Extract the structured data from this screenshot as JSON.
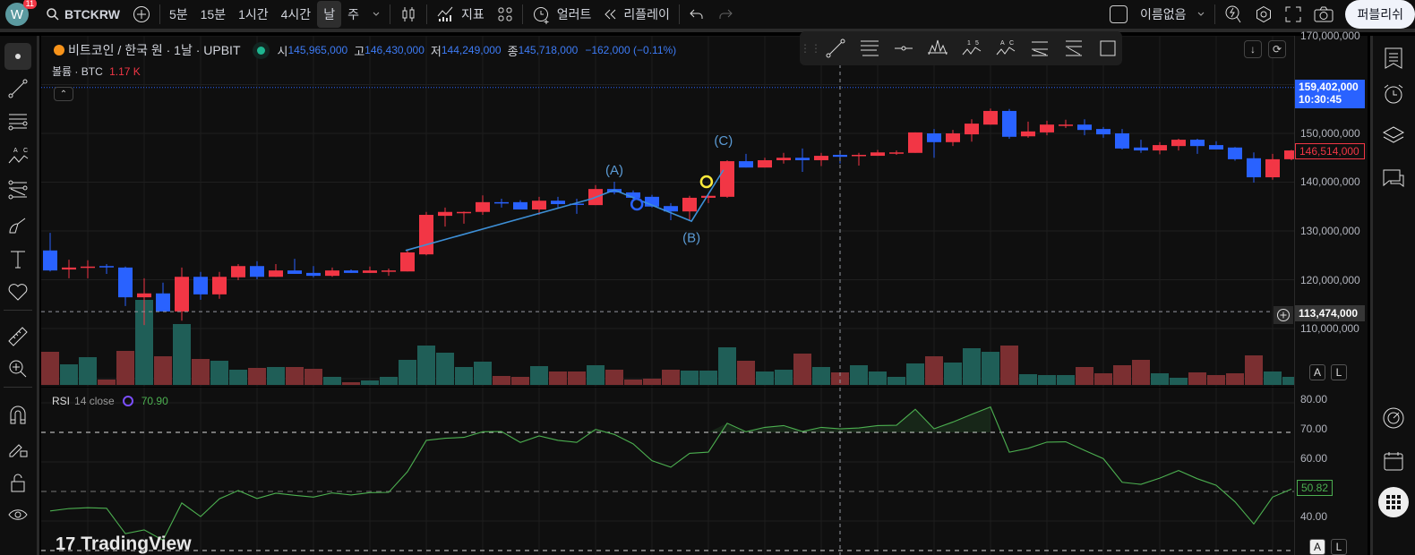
{
  "topbar": {
    "avatar_letter": "W",
    "notification_count": "11",
    "symbol": "BTCKRW",
    "timeframes": [
      "5분",
      "15분",
      "1시간",
      "4시간",
      "날",
      "주"
    ],
    "active_timeframe": "날",
    "indicators_label": "지표",
    "alert_label": "얼러트",
    "replay_label": "리플레이",
    "layout_name": "이름없음",
    "publish_label": "퍼블리쉬"
  },
  "legend": {
    "title": "비트코인 / 한국 원 · 1날 · UPBIT",
    "open_label": "시",
    "open": "145,965,000",
    "high_label": "고",
    "high": "146,430,000",
    "low_label": "저",
    "low": "144,249,000",
    "close_label": "종",
    "close": "145,718,000",
    "change": "−162,000 (−0.11%)"
  },
  "volume_legend": {
    "label": "볼륨 · BTC",
    "value": "1.17 K"
  },
  "rsi_legend": {
    "label": "RSI",
    "params": "14 close",
    "value": "70.90"
  },
  "price_axis": {
    "ticks": [
      "170,000,000",
      "150,000,000",
      "140,000,000",
      "130,000,000",
      "120,000,000",
      "110,000,000"
    ],
    "alert_price": "159,402,000",
    "countdown": "10:30:45",
    "last_price": "146,514,000",
    "crosshair_price": "113,474,000"
  },
  "rsi_axis": {
    "ticks": [
      "80.00",
      "70.00",
      "60.00",
      "40.00"
    ],
    "last_value": "50.82"
  },
  "axis_buttons": {
    "auto": "A",
    "log": "L"
  },
  "watermark": "TradingView",
  "colors": {
    "up": "#f23645",
    "down": "#2962ff",
    "vol_up": "#1f5e57",
    "vol_down": "#7b2f31",
    "rsi": "#4caf50",
    "wave": "#3d8fd6",
    "accent": "#2962ff"
  },
  "chart_data": {
    "type": "candlestick",
    "price_unit_note": "millions KRW",
    "ylim": [
      106,
      172
    ],
    "ohlc": [
      [
        126.0,
        129.6,
        121.7,
        121.9
      ],
      [
        122.1,
        124.1,
        120.3,
        122.5
      ],
      [
        122.6,
        124.0,
        120.3,
        122.7
      ],
      [
        122.8,
        123.2,
        121.2,
        122.6
      ],
      [
        122.5,
        122.7,
        114.6,
        116.4
      ],
      [
        116.4,
        120.3,
        110.7,
        117.2
      ],
      [
        117.2,
        119.4,
        113.5,
        113.5
      ],
      [
        113.5,
        122.5,
        111.6,
        120.6
      ],
      [
        120.6,
        121.6,
        115.9,
        117.0
      ],
      [
        117.0,
        121.6,
        116.1,
        120.6
      ],
      [
        120.5,
        123.2,
        119.9,
        122.8
      ],
      [
        122.8,
        123.8,
        120.1,
        120.6
      ],
      [
        120.6,
        123.2,
        120.6,
        121.9
      ],
      [
        121.9,
        124.3,
        121.2,
        121.2
      ],
      [
        121.4,
        122.8,
        120.5,
        120.8
      ],
      [
        120.8,
        122.5,
        120.6,
        121.9
      ],
      [
        121.9,
        122.1,
        121.4,
        121.4
      ],
      [
        121.4,
        122.7,
        121.4,
        121.9
      ],
      [
        121.7,
        122.3,
        120.8,
        121.9
      ],
      [
        121.7,
        126.2,
        121.7,
        125.6
      ],
      [
        125.2,
        133.9,
        125.0,
        133.3
      ],
      [
        133.1,
        134.8,
        130.9,
        133.9
      ],
      [
        133.7,
        134.0,
        131.5,
        133.9
      ],
      [
        133.9,
        137.3,
        133.3,
        135.9
      ],
      [
        135.9,
        136.6,
        134.8,
        135.7
      ],
      [
        135.9,
        136.3,
        134.4,
        134.4
      ],
      [
        134.4,
        137.0,
        133.3,
        136.2
      ],
      [
        136.2,
        137.0,
        134.8,
        135.5
      ],
      [
        135.6,
        136.6,
        133.5,
        135.5
      ],
      [
        135.3,
        139.4,
        135.3,
        138.6
      ],
      [
        138.6,
        140.1,
        137.5,
        137.9
      ],
      [
        137.9,
        138.3,
        136.6,
        136.8
      ],
      [
        137.0,
        137.4,
        134.8,
        135.0
      ],
      [
        135.1,
        135.7,
        132.2,
        134.0
      ],
      [
        134.0,
        137.2,
        132.2,
        136.8
      ],
      [
        136.8,
        137.7,
        135.7,
        137.2
      ],
      [
        137.0,
        144.5,
        136.8,
        144.3
      ],
      [
        144.3,
        145.8,
        143.0,
        143.0
      ],
      [
        143.0,
        145.0,
        143.0,
        144.5
      ],
      [
        144.5,
        146.0,
        143.8,
        145.0
      ],
      [
        145.0,
        146.9,
        142.1,
        144.5
      ],
      [
        144.5,
        146.0,
        143.3,
        145.4
      ],
      [
        145.6,
        145.8,
        143.8,
        145.2
      ],
      [
        145.4,
        146.0,
        143.4,
        145.6
      ],
      [
        145.4,
        146.6,
        145.4,
        146.1
      ],
      [
        145.9,
        146.5,
        145.6,
        146.1
      ],
      [
        146.0,
        150.2,
        146.0,
        150.2
      ],
      [
        150.0,
        150.9,
        145.0,
        148.2
      ],
      [
        148.2,
        150.7,
        147.4,
        150.0
      ],
      [
        149.8,
        152.9,
        148.3,
        152.0
      ],
      [
        151.8,
        155.1,
        151.8,
        154.6
      ],
      [
        154.6,
        155.0,
        148.9,
        149.3
      ],
      [
        149.4,
        152.4,
        149.1,
        150.4
      ],
      [
        150.2,
        152.6,
        149.6,
        151.8
      ],
      [
        151.7,
        152.8,
        151.1,
        151.8
      ],
      [
        151.8,
        152.9,
        149.6,
        150.7
      ],
      [
        150.9,
        151.3,
        149.1,
        149.8
      ],
      [
        150.0,
        150.9,
        146.7,
        146.9
      ],
      [
        147.1,
        148.7,
        146.0,
        146.5
      ],
      [
        146.5,
        148.2,
        145.7,
        147.6
      ],
      [
        147.4,
        148.9,
        146.5,
        148.7
      ],
      [
        148.7,
        148.9,
        145.8,
        147.4
      ],
      [
        147.6,
        148.4,
        146.7,
        146.7
      ],
      [
        147.1,
        147.2,
        144.4,
        144.7
      ],
      [
        144.9,
        146.1,
        139.9,
        141.0
      ],
      [
        141.0,
        145.8,
        140.5,
        144.7
      ],
      [
        144.7,
        146.6,
        144.5,
        146.5
      ]
    ],
    "volume_k": [
      4.81,
      2.99,
      4.03,
      0.78,
      4.94,
      12.35,
      4.16,
      8.84,
      3.77,
      3.51,
      2.21,
      2.47,
      2.6,
      2.6,
      2.34,
      1.17,
      0.39,
      0.65,
      1.17,
      3.64,
      5.72,
      4.68,
      2.6,
      3.38,
      1.3,
      1.17,
      2.73,
      1.95,
      1.95,
      2.86,
      2.21,
      0.78,
      0.91,
      2.21,
      2.08,
      2.08,
      5.46,
      3.51,
      1.95,
      2.21,
      4.55,
      2.6,
      1.82,
      2.86,
      1.95,
      1.17,
      3.12,
      4.16,
      3.25,
      5.33,
      4.81,
      5.72,
      1.56,
      1.43,
      1.43,
      2.6,
      1.69,
      2.86,
      3.64,
      1.69,
      1.04,
      1.82,
      1.43,
      1.69,
      4.29,
      1.95,
      1.17
    ],
    "rsi": [
      43.4,
      44.2,
      44.5,
      44.3,
      35.7,
      37.0,
      33.5,
      46.1,
      41.5,
      47.5,
      50.3,
      47.6,
      49.4,
      48.7,
      48.1,
      49.5,
      48.8,
      49.6,
      49.7,
      56.7,
      67.3,
      68.0,
      68.3,
      70.2,
      70.3,
      66.6,
      68.8,
      67.3,
      66.6,
      71.0,
      69.3,
      66.1,
      60.4,
      58.2,
      62.9,
      63.3,
      73.1,
      70.2,
      71.7,
      72.3,
      70.3,
      71.7,
      71.2,
      71.5,
      72.3,
      72.4,
      77.8,
      71.2,
      73.5,
      76.1,
      78.6,
      63.3,
      64.6,
      66.7,
      66.8,
      63.9,
      61.1,
      53.1,
      52.4,
      54.5,
      57.1,
      54.3,
      52.1,
      46.5,
      39.0,
      48.1,
      50.8
    ],
    "rsi_levels": [
      70,
      50,
      30
    ],
    "rsi_ylim": [
      25,
      90
    ],
    "price_grid": [
      110,
      120,
      130,
      140,
      150,
      160,
      170
    ],
    "alert_level": 159.402,
    "crosshair": {
      "index": 42,
      "price": 113.474
    },
    "wave": {
      "points": [
        [
          18.9,
          126.0
        ],
        [
          28.8,
          136.6
        ],
        [
          30.0,
          138.4
        ],
        [
          34.1,
          132.0
        ],
        [
          35.8,
          142.5
        ]
      ],
      "labels": [
        {
          "text": "(A)",
          "i": 30.0,
          "p": 141.6
        },
        {
          "text": "(B)",
          "i": 34.1,
          "p": 127.7
        },
        {
          "text": "(C)",
          "i": 35.8,
          "p": 147.6
        }
      ],
      "markers": [
        {
          "i": 31.2,
          "p": 135.5,
          "color": "#2962ff"
        },
        {
          "i": 34.9,
          "p": 140.1,
          "color": "#ffeb3b"
        }
      ]
    }
  }
}
